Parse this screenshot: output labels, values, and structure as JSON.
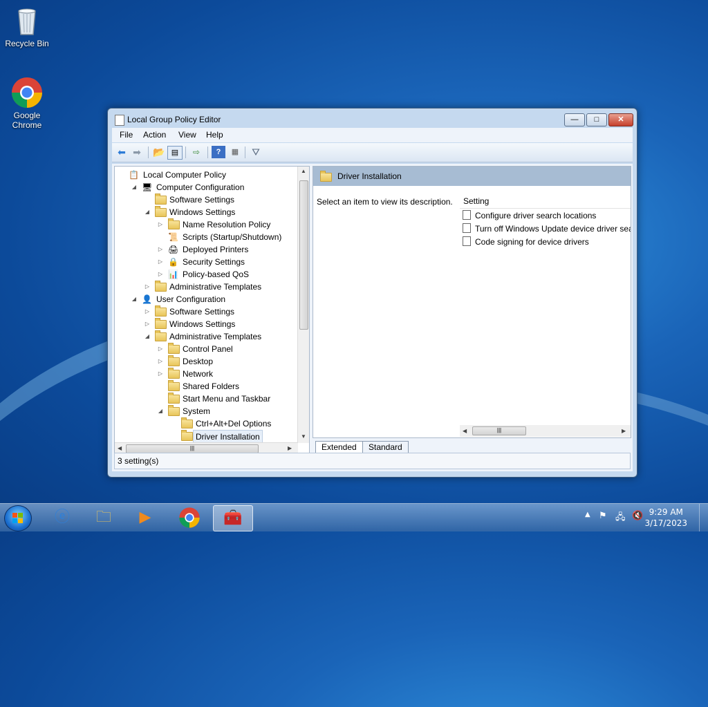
{
  "desktop": {
    "icons": [
      {
        "label": "Recycle Bin"
      },
      {
        "label": "Google Chrome"
      }
    ]
  },
  "window": {
    "title": "Local Group Policy Editor",
    "controls": {
      "minimize": "—",
      "maximize": "□",
      "close": "✕"
    },
    "menu": [
      "File",
      "Action",
      "View",
      "Help"
    ],
    "toolbar": [
      "back-icon",
      "forward-icon",
      "up-folder-icon",
      "show-hide-tree-icon",
      "export-list-icon",
      "help-icon",
      "properties-icon",
      "filter-icon"
    ]
  },
  "tree": {
    "items": [
      {
        "label": "Local Computer Policy",
        "indent": 0,
        "arrow": "",
        "icon": "policy"
      },
      {
        "label": "Computer Configuration",
        "indent": 1,
        "arrow": "◢",
        "icon": "computer"
      },
      {
        "label": "Software Settings",
        "indent": 2,
        "arrow": "",
        "icon": "folder"
      },
      {
        "label": "Windows Settings",
        "indent": 2,
        "arrow": "◢",
        "icon": "folder"
      },
      {
        "label": "Name Resolution Policy",
        "indent": 3,
        "arrow": "▷",
        "icon": "folder"
      },
      {
        "label": "Scripts (Startup/Shutdown)",
        "indent": 3,
        "arrow": "",
        "icon": "script"
      },
      {
        "label": "Deployed Printers",
        "indent": 3,
        "arrow": "▷",
        "icon": "printer"
      },
      {
        "label": "Security Settings",
        "indent": 3,
        "arrow": "▷",
        "icon": "security"
      },
      {
        "label": "Policy-based QoS",
        "indent": 3,
        "arrow": "▷",
        "icon": "chart"
      },
      {
        "label": "Administrative Templates",
        "indent": 2,
        "arrow": "▷",
        "icon": "folder"
      },
      {
        "label": "User Configuration",
        "indent": 1,
        "arrow": "◢",
        "icon": "user"
      },
      {
        "label": "Software Settings",
        "indent": 2,
        "arrow": "▷",
        "icon": "folder"
      },
      {
        "label": "Windows Settings",
        "indent": 2,
        "arrow": "▷",
        "icon": "folder"
      },
      {
        "label": "Administrative Templates",
        "indent": 2,
        "arrow": "◢",
        "icon": "folder"
      },
      {
        "label": "Control Panel",
        "indent": 3,
        "arrow": "▷",
        "icon": "folder"
      },
      {
        "label": "Desktop",
        "indent": 3,
        "arrow": "▷",
        "icon": "folder"
      },
      {
        "label": "Network",
        "indent": 3,
        "arrow": "▷",
        "icon": "folder"
      },
      {
        "label": "Shared Folders",
        "indent": 3,
        "arrow": "",
        "icon": "folder"
      },
      {
        "label": "Start Menu and Taskbar",
        "indent": 3,
        "arrow": "",
        "icon": "folder"
      },
      {
        "label": "System",
        "indent": 3,
        "arrow": "◢",
        "icon": "folder"
      },
      {
        "label": "Ctrl+Alt+Del Options",
        "indent": 4,
        "arrow": "",
        "icon": "folder"
      },
      {
        "label": "Driver Installation",
        "indent": 4,
        "arrow": "",
        "icon": "folder",
        "selected": true
      }
    ]
  },
  "details": {
    "header": "Driver Installation",
    "description": "Select an item to view its description.",
    "column": "Setting",
    "settings": [
      "Configure driver search locations",
      "Turn off Windows Update device driver sea",
      "Code signing for device drivers"
    ],
    "tabs": [
      "Extended",
      "Standard"
    ]
  },
  "status": "3 setting(s)",
  "taskbar": {
    "apps": [
      "internet-explorer-icon",
      "file-explorer-icon",
      "media-player-icon",
      "chrome-icon",
      "group-policy-editor-icon"
    ],
    "time": "9:29 AM",
    "date": "3/17/2023"
  }
}
